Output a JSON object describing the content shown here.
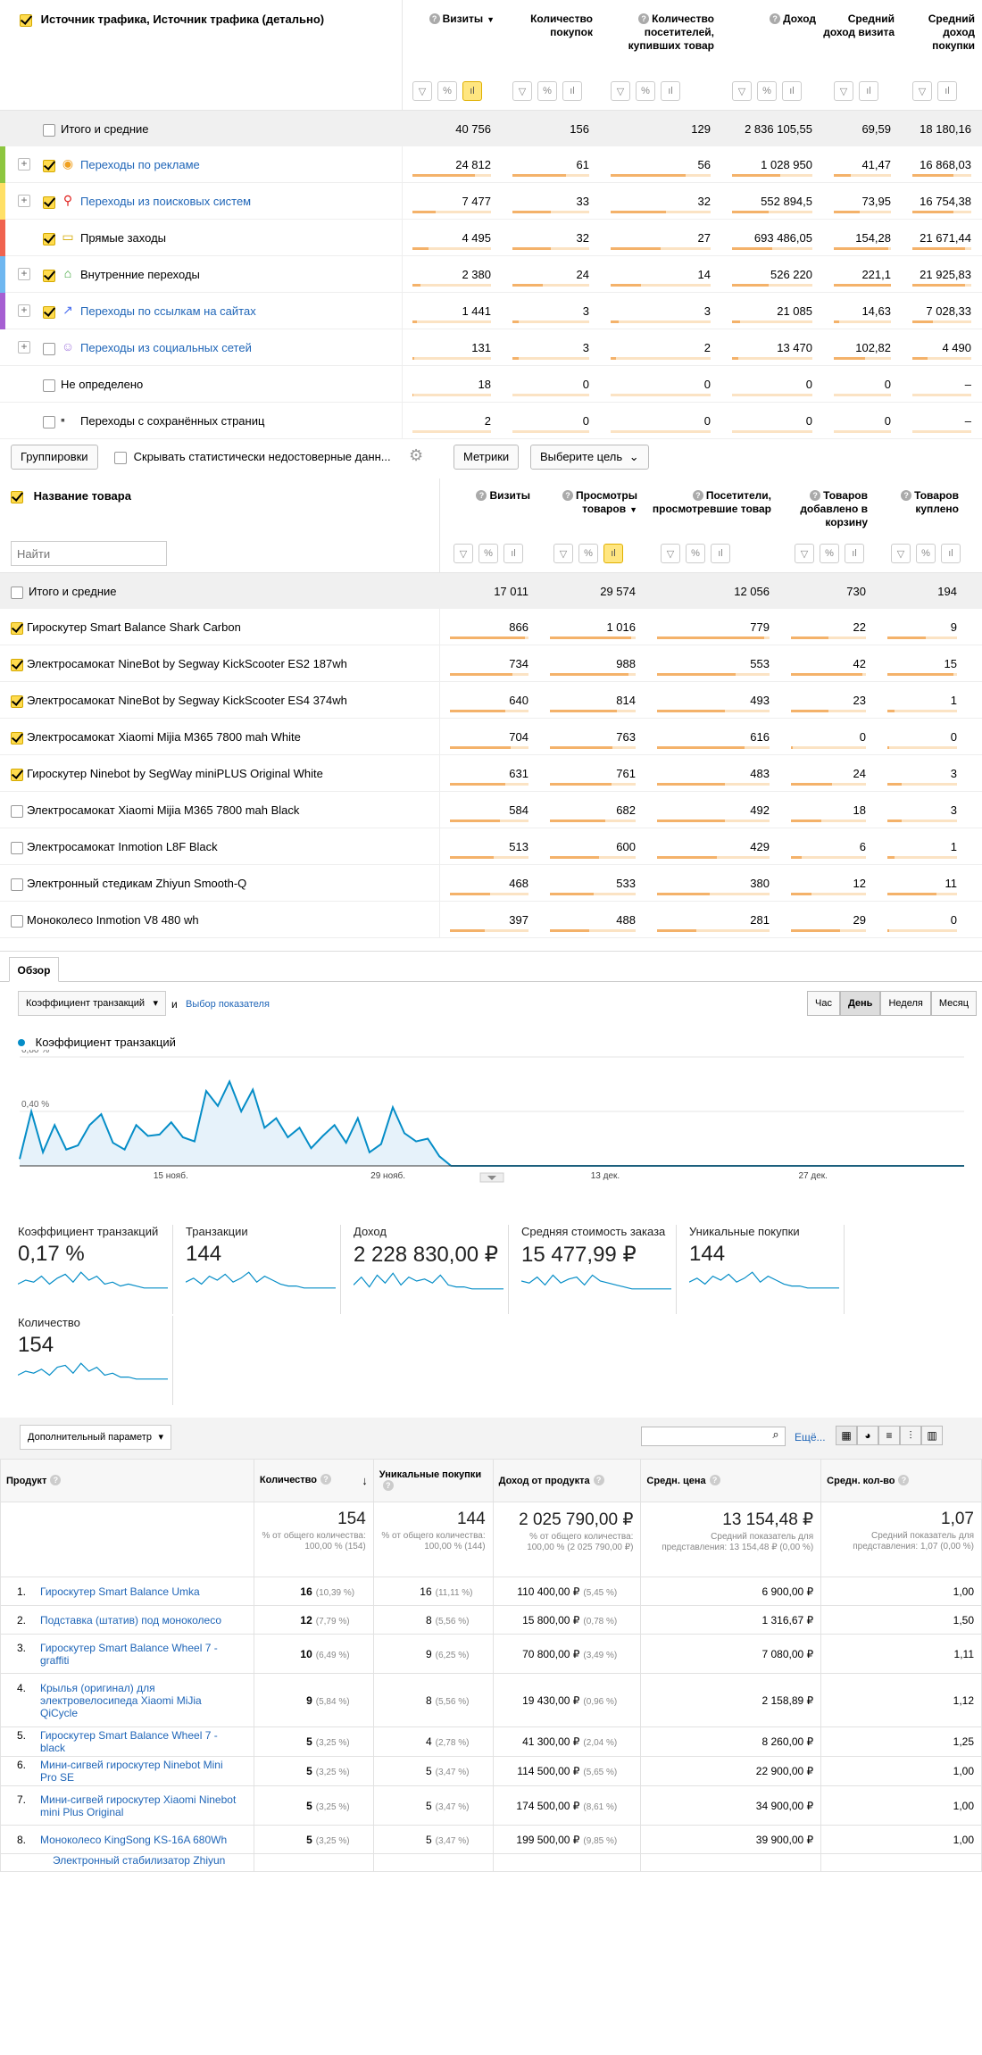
{
  "traffic": {
    "header": {
      "title": "Источник трафика, Источник трафика (детально)",
      "cols": [
        "Визиты",
        "Количество покупок",
        "Количество посетителей, купивших товар",
        "Доход",
        "Средний доход визита",
        "Средний доход покупки"
      ],
      "sort_mark": "▼"
    },
    "totals": {
      "label": "Итого и средние",
      "values": [
        "40 756",
        "156",
        "129",
        "2 836 105,55",
        "69,59",
        "18 180,16"
      ]
    },
    "rows": [
      {
        "label": "Переходы по рекламе",
        "values": [
          "24 812",
          "61",
          "56",
          "1 028 950",
          "41,47",
          "16 868,03"
        ],
        "color": "#8dc63f",
        "checked": true,
        "expand": "+",
        "link": true
      },
      {
        "label": "Переходы из поисковых систем",
        "values": [
          "7 477",
          "33",
          "32",
          "552 894,5",
          "73,95",
          "16 754,38"
        ],
        "color": "#ffe066",
        "checked": true,
        "expand": "+",
        "link": true
      },
      {
        "label": "Прямые заходы",
        "values": [
          "4 495",
          "32",
          "27",
          "693 486,05",
          "154,28",
          "21 671,44"
        ],
        "color": "#f0634f",
        "checked": true,
        "expand": "",
        "link": false
      },
      {
        "label": "Внутренние переходы",
        "values": [
          "2 380",
          "24",
          "14",
          "526 220",
          "221,1",
          "21 925,83"
        ],
        "color": "#6fb7f0",
        "checked": true,
        "expand": "+",
        "link": false
      },
      {
        "label": "Переходы по ссылкам на сайтах",
        "values": [
          "1 441",
          "3",
          "3",
          "21 085",
          "14,63",
          "7 028,33"
        ],
        "color": "#a65fd2",
        "checked": true,
        "expand": "+",
        "link": true
      },
      {
        "label": "Переходы из социальных сетей",
        "values": [
          "131",
          "3",
          "2",
          "13 470",
          "102,82",
          "4 490"
        ],
        "color": "",
        "checked": false,
        "expand": "+",
        "link": true
      },
      {
        "label": "Не определено",
        "values": [
          "18",
          "0",
          "0",
          "0",
          "0",
          "–"
        ],
        "color": "",
        "checked": false,
        "expand": "",
        "link": false
      },
      {
        "label": "Переходы с сохранённых страниц",
        "values": [
          "2",
          "0",
          "0",
          "0",
          "0",
          "–"
        ],
        "color": "",
        "checked": false,
        "expand": "",
        "link": false
      }
    ],
    "ratios": [
      [
        0.8,
        0.7,
        0.75,
        0.6,
        0.3,
        0.7
      ],
      [
        0.3,
        0.5,
        0.55,
        0.45,
        0.45,
        0.7
      ],
      [
        0.2,
        0.5,
        0.5,
        0.5,
        0.95,
        0.9
      ],
      [
        0.1,
        0.4,
        0.3,
        0.45,
        1.0,
        0.9
      ],
      [
        0.06,
        0.08,
        0.08,
        0.1,
        0.1,
        0.35
      ],
      [
        0.02,
        0.08,
        0.05,
        0.08,
        0.55,
        0.25
      ],
      [
        0.01,
        0,
        0,
        0,
        0,
        0
      ],
      [
        0.005,
        0,
        0,
        0,
        0,
        0
      ]
    ]
  },
  "toolbar": {
    "group_btn": "Группировки",
    "hide_label": "Скрывать статистически недостоверные данн...",
    "metrics_btn": "Метрики",
    "goal_btn": "Выберите цель"
  },
  "products": {
    "header": {
      "title": "Название товара",
      "search_placeholder": "Найти",
      "cols": [
        "Визиты",
        "Просмотры товаров",
        "Посетители, просмотревшие товар",
        "Товаров добавлено в корзину",
        "Товаров куплено"
      ],
      "sort_mark": "▼"
    },
    "totals": {
      "label": "Итого и средние",
      "values": [
        "17 011",
        "29 574",
        "12 056",
        "730",
        "194"
      ]
    },
    "rows": [
      {
        "label": "Гироскутер Smart Balance Shark Carbon",
        "values": [
          "866",
          "1 016",
          "779",
          "22",
          "9"
        ],
        "checked": true
      },
      {
        "label": "Электросамокат NineBot by Segway KickScooter ES2 187wh",
        "values": [
          "734",
          "988",
          "553",
          "42",
          "15"
        ],
        "checked": true
      },
      {
        "label": "Электросамокат NineBot by Segway KickScooter ES4 374wh",
        "values": [
          "640",
          "814",
          "493",
          "23",
          "1"
        ],
        "checked": true
      },
      {
        "label": "Электросамокат Xiaomi Mijia M365 7800 mah White",
        "values": [
          "704",
          "763",
          "616",
          "0",
          "0"
        ],
        "checked": true
      },
      {
        "label": "Гироскутер Ninebot by SegWay miniPLUS Original White",
        "values": [
          "631",
          "761",
          "483",
          "24",
          "3"
        ],
        "checked": true
      },
      {
        "label": "Электросамокат Xiaomi Mijia M365 7800 mah Black",
        "values": [
          "584",
          "682",
          "492",
          "18",
          "3"
        ],
        "checked": false
      },
      {
        "label": "Электросамокат Inmotion L8F Black",
        "values": [
          "513",
          "600",
          "429",
          "6",
          "1"
        ],
        "checked": false
      },
      {
        "label": "Электронный стедикам Zhiyun Smooth-Q",
        "values": [
          "468",
          "533",
          "380",
          "12",
          "11"
        ],
        "checked": false
      },
      {
        "label": "Моноколесо Inmotion V8 480 wh",
        "values": [
          "397",
          "488",
          "281",
          "29",
          "0"
        ],
        "checked": false
      }
    ],
    "ratios": [
      [
        0.95,
        0.95,
        0.95,
        0.5,
        0.55
      ],
      [
        0.8,
        0.92,
        0.7,
        0.95,
        0.95
      ],
      [
        0.7,
        0.78,
        0.6,
        0.5,
        0.1
      ],
      [
        0.77,
        0.73,
        0.78,
        0.02,
        0.02
      ],
      [
        0.7,
        0.72,
        0.6,
        0.55,
        0.2
      ],
      [
        0.64,
        0.65,
        0.6,
        0.4,
        0.2
      ],
      [
        0.56,
        0.57,
        0.53,
        0.14,
        0.1
      ],
      [
        0.51,
        0.51,
        0.47,
        0.27,
        0.7
      ],
      [
        0.44,
        0.46,
        0.35,
        0.65,
        0.02
      ]
    ]
  },
  "ga": {
    "tab": "Обзор",
    "metric_select": "Коэффициент транзакций",
    "and": "и",
    "choose": "Выбор показателя",
    "periods": [
      "Час",
      "День",
      "Неделя",
      "Месяц"
    ],
    "active_period": 1,
    "legend": "Коэффициент транзакций",
    "series_color": "#058dc7",
    "y_ticks": [
      "0,80 %",
      "0,40 %"
    ],
    "x_ticks": [
      "15 нояб.",
      "29 нояб.",
      "13 дек.",
      "27 дек."
    ],
    "cards": [
      {
        "label": "Коэффициент транзакций",
        "value": "0,17 %"
      },
      {
        "label": "Транзакции",
        "value": "144"
      },
      {
        "label": "Доход",
        "value": "2 228 830,00 ₽"
      },
      {
        "label": "Средняя стоимость заказа",
        "value": "15 477,99 ₽"
      },
      {
        "label": "Уникальные покупки",
        "value": "144"
      },
      {
        "label": "Количество",
        "value": "154"
      }
    ],
    "secondary": "Дополнительный параметр",
    "more": "Ещё...",
    "table": {
      "cols": [
        "Продукт",
        "Количество",
        "Уникальные покупки",
        "Доход от продукта",
        "Средн. цена",
        "Средн. кол-во"
      ],
      "totals": [
        {
          "value": "154",
          "sub": "% от общего количества: 100,00 % (154)"
        },
        {
          "value": "144",
          "sub": "% от общего количества: 100,00 % (144)"
        },
        {
          "value": "2 025 790,00 ₽",
          "sub": "% от общего количества: 100,00 % (2 025 790,00 ₽)"
        },
        {
          "value": "13 154,48 ₽",
          "sub": "Средний показатель для представления: 13 154,48 ₽ (0,00 %)"
        },
        {
          "value": "1,07",
          "sub": "Средний показатель для представления: 1,07 (0,00 %)"
        }
      ],
      "rows": [
        {
          "n": "1.",
          "name": "Гироскутер Smart Balance Umka",
          "qty": "16",
          "qty_p": "(10,39 %)",
          "uniq": "16",
          "uniq_p": "(11,11 %)",
          "rev": "110 400,00 ₽",
          "rev_p": "(5,45 %)",
          "price": "6 900,00 ₽",
          "avg": "1,00"
        },
        {
          "n": "2.",
          "name": "Подставка (штатив) под моноколесо",
          "qty": "12",
          "qty_p": "(7,79 %)",
          "uniq": "8",
          "uniq_p": "(5,56 %)",
          "rev": "15 800,00 ₽",
          "rev_p": "(0,78 %)",
          "price": "1 316,67 ₽",
          "avg": "1,50"
        },
        {
          "n": "3.",
          "name": "Гироскутер Smart Balance Wheel 7 - graffiti",
          "qty": "10",
          "qty_p": "(6,49 %)",
          "uniq": "9",
          "uniq_p": "(6,25 %)",
          "rev": "70 800,00 ₽",
          "rev_p": "(3,49 %)",
          "price": "7 080,00 ₽",
          "avg": "1,11"
        },
        {
          "n": "4.",
          "name": "Крылья (оригинал) для электровелосипеда Xiaomi MiJia QiCycle",
          "qty": "9",
          "qty_p": "(5,84 %)",
          "uniq": "8",
          "uniq_p": "(5,56 %)",
          "rev": "19 430,00 ₽",
          "rev_p": "(0,96 %)",
          "price": "2 158,89 ₽",
          "avg": "1,12"
        },
        {
          "n": "5.",
          "name": "Гироскутер Smart Balance Wheel 7 - black",
          "qty": "5",
          "qty_p": "(3,25 %)",
          "uniq": "4",
          "uniq_p": "(2,78 %)",
          "rev": "41 300,00 ₽",
          "rev_p": "(2,04 %)",
          "price": "8 260,00 ₽",
          "avg": "1,25"
        },
        {
          "n": "6.",
          "name": "Мини-сигвей гироскутер Ninebot Mini Pro SE",
          "qty": "5",
          "qty_p": "(3,25 %)",
          "uniq": "5",
          "uniq_p": "(3,47 %)",
          "rev": "114 500,00 ₽",
          "rev_p": "(5,65 %)",
          "price": "22 900,00 ₽",
          "avg": "1,00"
        },
        {
          "n": "7.",
          "name": "Мини-сигвей гироскутер Xiaomi Ninebot mini Plus Original",
          "qty": "5",
          "qty_p": "(3,25 %)",
          "uniq": "5",
          "uniq_p": "(3,47 %)",
          "rev": "174 500,00 ₽",
          "rev_p": "(8,61 %)",
          "price": "34 900,00 ₽",
          "avg": "1,00"
        },
        {
          "n": "8.",
          "name": "Моноколесо KingSong KS-16A 680Wh",
          "qty": "5",
          "qty_p": "(3,25 %)",
          "uniq": "5",
          "uniq_p": "(3,47 %)",
          "rev": "199 500,00 ₽",
          "rev_p": "(9,85 %)",
          "price": "39 900,00 ₽",
          "avg": "1,00"
        }
      ],
      "cut_row": "Электронный стабилизатор Zhiyun"
    }
  },
  "chart_data": {
    "type": "line",
    "series": [
      {
        "name": "Коэффициент транзакций",
        "values": [
          0.05,
          0.4,
          0.1,
          0.3,
          0.12,
          0.15,
          0.3,
          0.38,
          0.17,
          0.12,
          0.3,
          0.22,
          0.23,
          0.32,
          0.21,
          0.18,
          0.55,
          0.44,
          0.62,
          0.4,
          0.56,
          0.28,
          0.35,
          0.21,
          0.28,
          0.13,
          0.22,
          0.3,
          0.17,
          0.35,
          0.1,
          0.16,
          0.43,
          0.24,
          0.18,
          0.2,
          0.07,
          0,
          0,
          0,
          0,
          0,
          0,
          0,
          0,
          0,
          0,
          0,
          0,
          0,
          0,
          0,
          0,
          0,
          0,
          0,
          0,
          0,
          0,
          0,
          0,
          0,
          0,
          0,
          0,
          0,
          0,
          0,
          0,
          0,
          0,
          0,
          0,
          0,
          0,
          0,
          0,
          0,
          0,
          0,
          0,
          0
        ]
      }
    ],
    "x_ticks": [
      "15 нояб.",
      "29 нояб.",
      "13 дек.",
      "27 дек."
    ],
    "ylim": [
      0,
      0.8
    ],
    "y_ticks": [
      "0,80 %",
      "0,40 %"
    ],
    "grid": true
  }
}
